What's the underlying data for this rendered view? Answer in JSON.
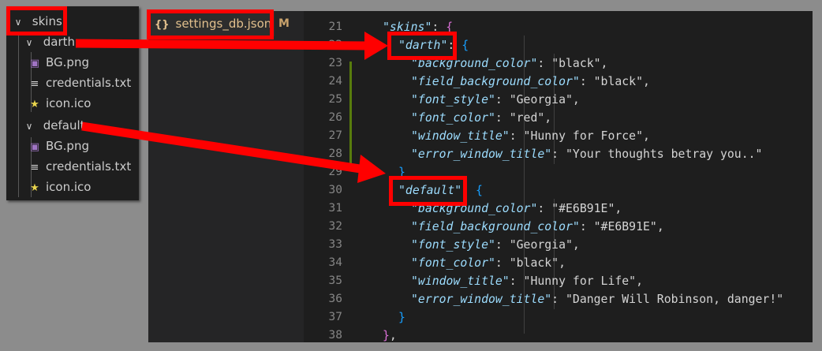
{
  "tree": {
    "root": "skins",
    "folders": [
      {
        "name": "darth",
        "files": [
          {
            "name": "BG.png",
            "icon": "image-icon"
          },
          {
            "name": "credentials.txt",
            "icon": "text-file-icon"
          },
          {
            "name": "icon.ico",
            "icon": "star-icon"
          }
        ]
      },
      {
        "name": "default",
        "files": [
          {
            "name": "BG.png",
            "icon": "image-icon"
          },
          {
            "name": "credentials.txt",
            "icon": "text-file-icon"
          },
          {
            "name": "icon.ico",
            "icon": "star-icon"
          }
        ]
      }
    ]
  },
  "editor": {
    "tab": {
      "icon": "{}",
      "filename": "settings_db.json",
      "status": "M"
    },
    "line_numbers": [
      "21",
      "22",
      "23",
      "24",
      "25",
      "26",
      "27",
      "28",
      "29",
      "30",
      "31",
      "32",
      "33",
      "34",
      "35",
      "36",
      "37",
      "38"
    ],
    "lines": {
      "l21_key": "\"skins\"",
      "l21_punct": ": ",
      "l21_brace": "{",
      "l22_key": "\"darth\"",
      "l22_punct": ": ",
      "l22_brace": "{",
      "l23_key": "\"background_color\"",
      "l23_punct": ": ",
      "l23_val": "\"black\"",
      "l23_end": ",",
      "l24_key": "\"field_background_color\"",
      "l24_punct": ": ",
      "l24_val": "\"black\"",
      "l24_end": ",",
      "l25_key": "\"font_style\"",
      "l25_punct": ": ",
      "l25_val": "\"Georgia\"",
      "l25_end": ",",
      "l26_key": "\"font_color\"",
      "l26_punct": ": ",
      "l26_val": "\"red\"",
      "l26_end": ",",
      "l27_key": "\"window_title\"",
      "l27_punct": ": ",
      "l27_val": "\"Hunny for Force\"",
      "l27_end": ",",
      "l28_key": "\"error_window_title\"",
      "l28_punct": ": ",
      "l28_val": "\"Your thoughts betray you..\"",
      "l29_brace": "}",
      "l30_key": "\"default\"",
      "l30_punct": ": ",
      "l30_brace": "{",
      "l31_key": "\"background_color\"",
      "l31_punct": ": ",
      "l31_val": "\"#E6B91E\"",
      "l31_end": ",",
      "l32_key": "\"field_background_color\"",
      "l32_punct": ": ",
      "l32_val": "\"#E6B91E\"",
      "l32_end": ",",
      "l33_key": "\"font_style\"",
      "l33_punct": ": ",
      "l33_val": "\"Georgia\"",
      "l33_end": ",",
      "l34_key": "\"font_color\"",
      "l34_punct": ": ",
      "l34_val": "\"black\"",
      "l34_end": ",",
      "l35_key": "\"window_title\"",
      "l35_punct": ": ",
      "l35_val": "\"Hunny for Life\"",
      "l35_end": ",",
      "l36_key": "\"error_window_title\"",
      "l36_punct": ": ",
      "l36_val": "\"Danger Will Robinson, danger!\"",
      "l37_brace": "}",
      "l38_brace": "}",
      "l38_end": ","
    }
  },
  "annotations": {
    "highlight_color": "#ff0000"
  }
}
